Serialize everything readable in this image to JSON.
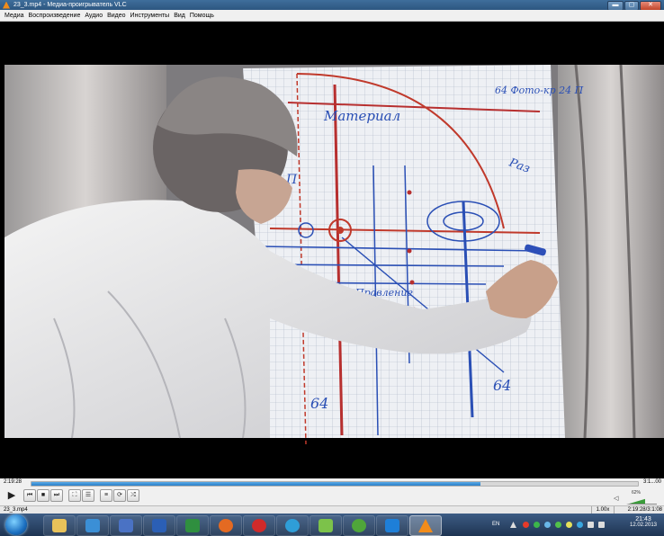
{
  "window": {
    "title": "23_3.mp4 - Медиа-проигрыватель VLC",
    "minimize_icon": "minimize-icon",
    "maximize_icon": "maximize-icon",
    "close_icon": "close-icon"
  },
  "menu": {
    "items": [
      "Медиа",
      "Воспроизведение",
      "Аудио",
      "Видео",
      "Инструменты",
      "Вид",
      "Помощь"
    ]
  },
  "video": {
    "whiteboard_labels": {
      "top_right": "64 Фото-кр 24 П",
      "material": "Материал",
      "bottom_left": "64",
      "bottom_right": "64",
      "mid": "Правление",
      "side": "Раз",
      "left_mid": "П"
    }
  },
  "player": {
    "elapsed": "2:19:28",
    "remaining": "3:1...00",
    "progress": 0.74,
    "buttons": {
      "play": "play-icon",
      "prev": "previous-icon",
      "stop": "stop-icon",
      "next": "next-icon",
      "fullscreen": "fullscreen-icon",
      "extended": "equalizer-icon",
      "playlist": "playlist-icon",
      "loop": "loop-icon",
      "shuffle": "shuffle-icon"
    },
    "volume_percent": "62%",
    "volume_level": 0.62
  },
  "status": {
    "file": "23_3.mp4",
    "speed": "1.00x",
    "time": "2:19:28/3:1:08"
  },
  "taskbar": {
    "apps": [
      "explorer-icon",
      "media-center-icon",
      "save-icon",
      "word-icon",
      "excel-icon",
      "firefox-icon",
      "yandex-icon",
      "mail-icon",
      "winamp-icon",
      "utorrent-icon",
      "teamviewer-icon",
      "vlc-icon"
    ],
    "tray": {
      "language": "EN"
    },
    "clock": {
      "time": "21:43",
      "date": "12.02.2013"
    }
  },
  "colors": {
    "accent": "#2a7fc8",
    "vlc_orange": "#f28c1a"
  }
}
